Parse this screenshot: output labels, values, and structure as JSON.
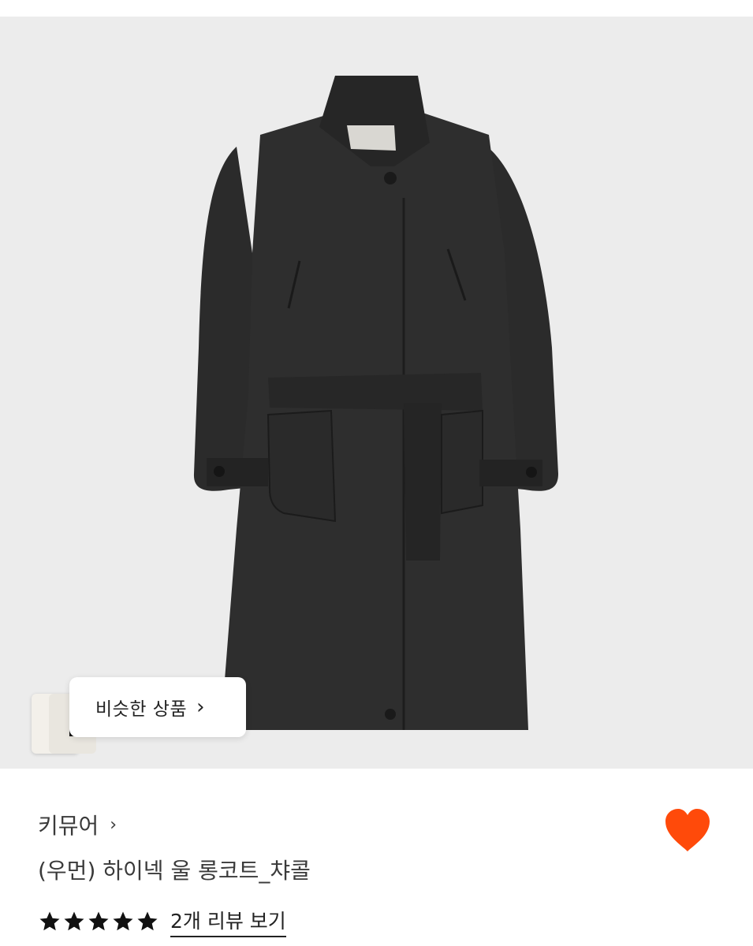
{
  "product_image": {
    "alt_icon": "coat-image",
    "background": "#ececec",
    "similar_button_label": "비슷한 상품"
  },
  "brand": {
    "name": "키뮤어",
    "chevron": "›"
  },
  "product": {
    "title": "(우먼) 하이넥 울 롱코트_챠콜",
    "wishlisted": true,
    "heart_color": "#ff4a0a"
  },
  "rating": {
    "stars": 5,
    "max_stars": 5,
    "review_link": "2개 리뷰 보기"
  },
  "colors": {
    "accent": "#ff4a0a",
    "text": "#3a3a3a"
  }
}
